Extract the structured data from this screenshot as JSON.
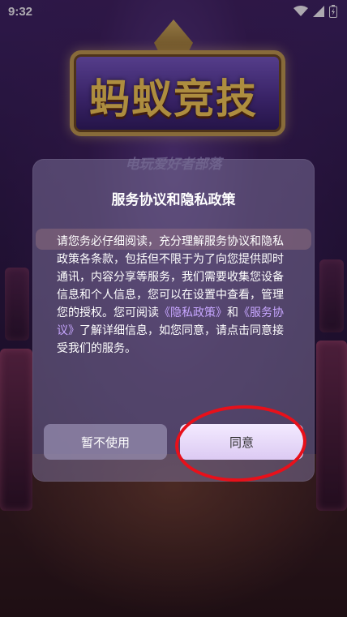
{
  "status_bar": {
    "time": "9:32",
    "icons": [
      "wifi-icon",
      "signal-icon",
      "battery-icon"
    ]
  },
  "app": {
    "logo_text": "蚂蚁竞技",
    "subtitle": "电玩爱好者部落"
  },
  "dialog": {
    "title": "服务协议和隐私政策",
    "body_part1": "请您务必仔细阅读，充分理解服务协议和隐私政策各条款，包括但不限于为了向您提供即时通讯，内容分享等服务，我们需要收集您设备信息和个人信息，您可以在设置中查看，管理您的授权。您可阅读",
    "privacy_link": "《隐私政策》",
    "and_text": "和",
    "service_link": "《服务协议》",
    "body_part2": "了解详细信息，如您同意，请点击同意接受我们的服务。",
    "decline_label": "暂不使用",
    "agree_label": "同意"
  },
  "colors": {
    "link": "#c7a6ff",
    "highlight_circle": "#e8101a"
  }
}
